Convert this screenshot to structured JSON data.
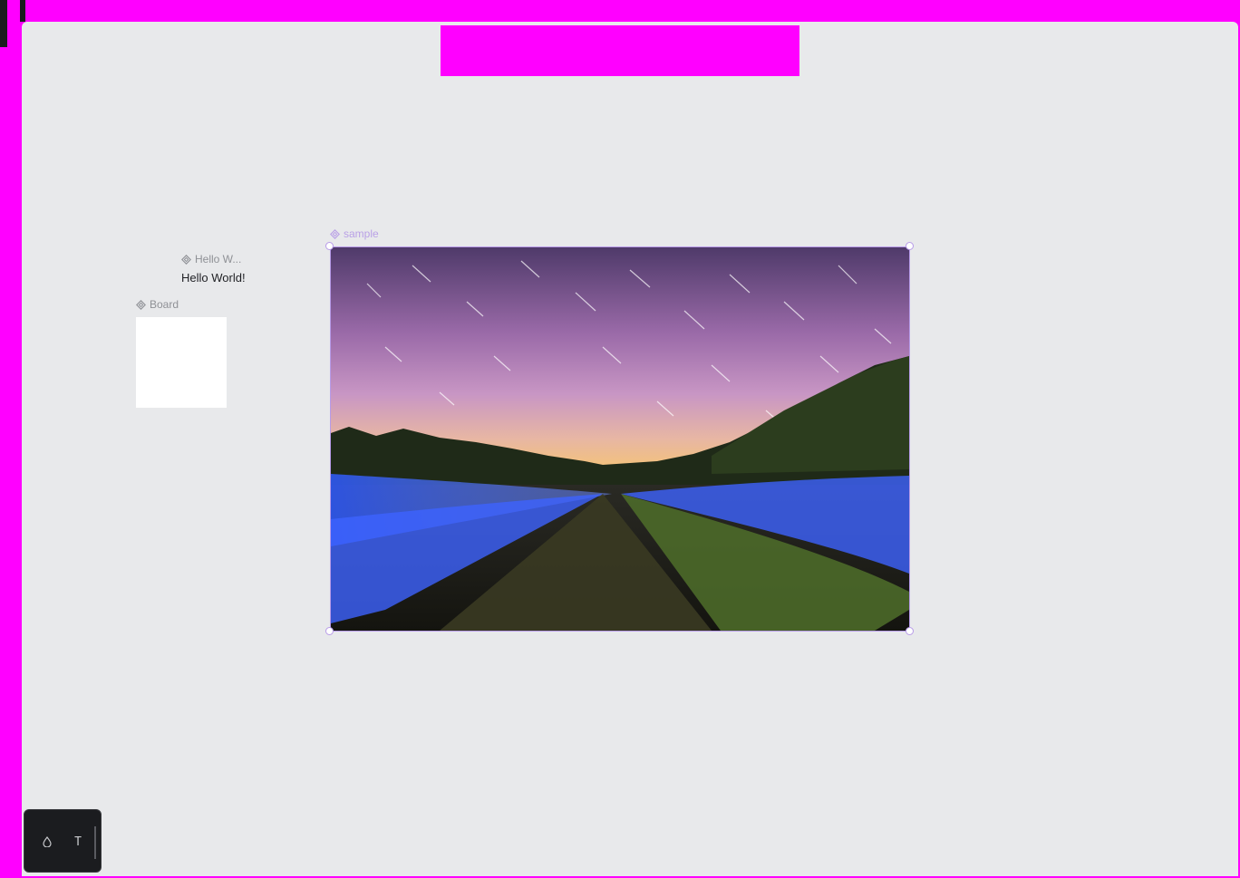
{
  "colors": {
    "accent": "#ff00ff",
    "canvas": "#e8e9eb",
    "selection": "#b79be8",
    "toolbar": "#1b1c1f"
  },
  "canvas": {
    "frames": [
      {
        "title": "Hello W...",
        "icon": "component-icon"
      },
      {
        "title": "Board",
        "icon": "component-icon"
      },
      {
        "title": "sample",
        "icon": "component-icon",
        "selected": true
      }
    ],
    "text_layer": "Hello World!",
    "image": {
      "description_icon": "landscape-image"
    }
  },
  "toolbar": {
    "tools": [
      {
        "name": "drop-icon",
        "glyph": "⬯"
      },
      {
        "name": "text-tool-icon",
        "glyph": "T"
      }
    ]
  }
}
